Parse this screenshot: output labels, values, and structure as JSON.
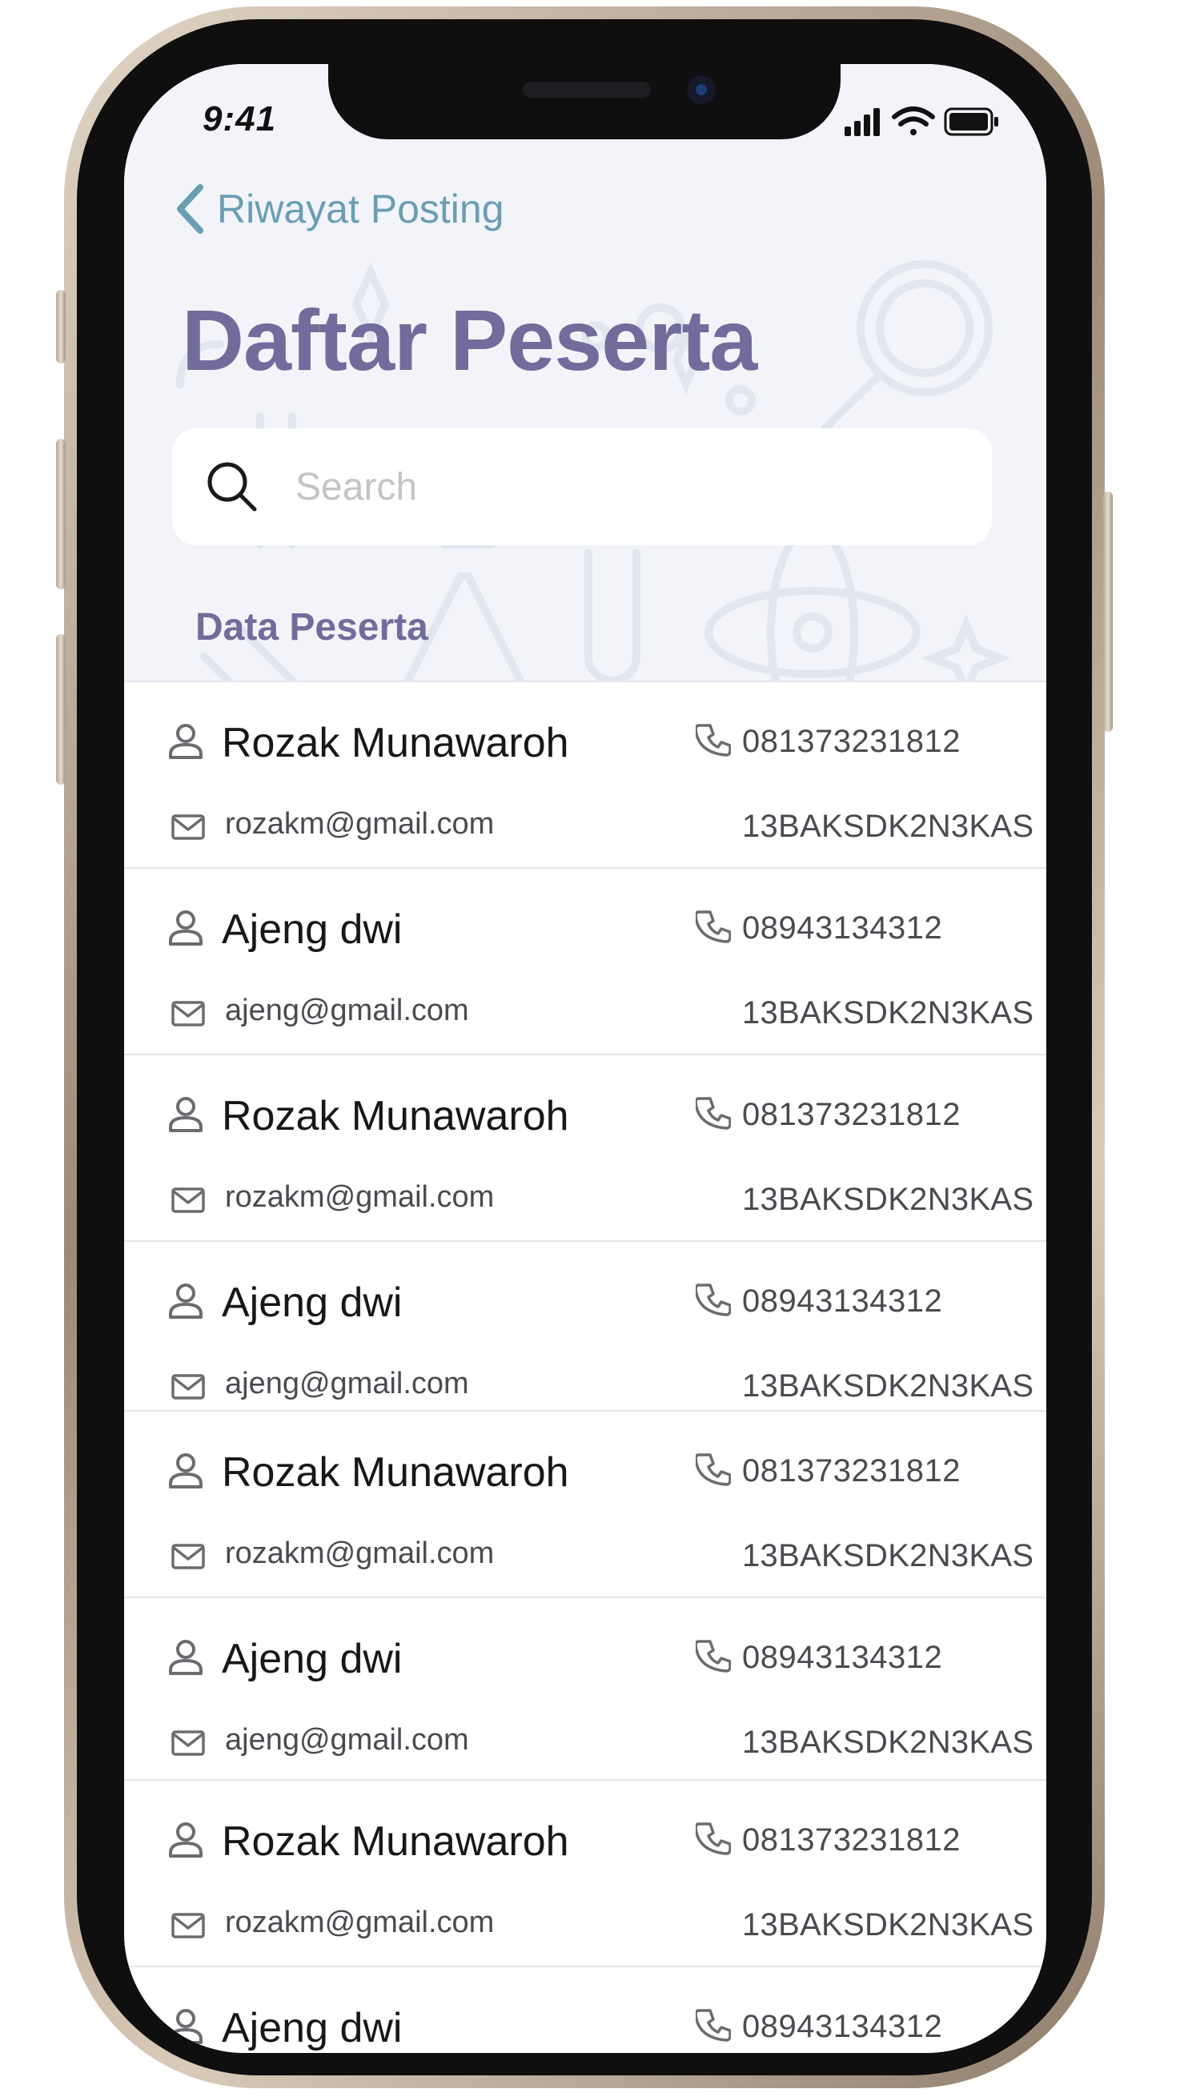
{
  "status_bar": {
    "time": "9:41"
  },
  "nav": {
    "back_label": "Riwayat Posting"
  },
  "page": {
    "title": "Daftar Peserta"
  },
  "search": {
    "placeholder": "Search",
    "value": ""
  },
  "section": {
    "label": "Data Peserta"
  },
  "participants": [
    {
      "name": "Rozak Munawaroh",
      "phone": "081373231812",
      "email": "rozakm@gmail.com",
      "code": "13BAKSDK2N3KAS"
    },
    {
      "name": "Ajeng dwi",
      "phone": "08943134312",
      "email": "ajeng@gmail.com",
      "code": "13BAKSDK2N3KAS"
    },
    {
      "name": "Rozak Munawaroh",
      "phone": "081373231812",
      "email": "rozakm@gmail.com",
      "code": "13BAKSDK2N3KAS"
    },
    {
      "name": "Ajeng dwi",
      "phone": "08943134312",
      "email": "ajeng@gmail.com",
      "code": "13BAKSDK2N3KAS"
    },
    {
      "name": "Rozak Munawaroh",
      "phone": "081373231812",
      "email": "rozakm@gmail.com",
      "code": "13BAKSDK2N3KAS"
    },
    {
      "name": "Ajeng dwi",
      "phone": "08943134312",
      "email": "ajeng@gmail.com",
      "code": "13BAKSDK2N3KAS"
    },
    {
      "name": "Rozak Munawaroh",
      "phone": "081373231812",
      "email": "rozakm@gmail.com",
      "code": "13BAKSDK2N3KAS"
    },
    {
      "name": "Ajeng dwi",
      "phone": "08943134312",
      "email": "",
      "code": ""
    }
  ],
  "icons": {
    "back": "chevron-left-icon",
    "search": "search-icon",
    "person": "person-icon",
    "phone": "phone-icon",
    "mail": "mail-icon",
    "signal": "signal-icon",
    "wifi": "wifi-icon",
    "battery": "battery-icon"
  },
  "colors": {
    "title": "#736b9c",
    "back_link": "#6a9eb2",
    "header_bg": "#f2f4f9",
    "text_primary": "#17171a",
    "text_secondary": "#4a4a50",
    "icon_gray": "#6b6b70"
  }
}
